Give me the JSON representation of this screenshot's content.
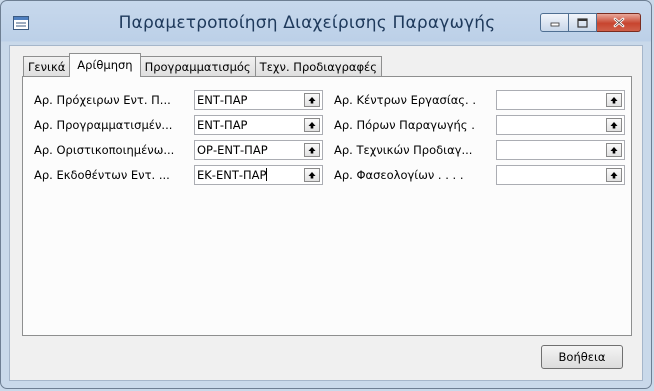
{
  "window": {
    "title": "Παραμετροποίηση Διαχείρισης Παραγωγής",
    "app_icon": "form-icon",
    "buttons": {
      "minimize": "minimize-icon",
      "maximize": "maximize-icon",
      "close": "close-icon"
    }
  },
  "tabs": [
    {
      "label": "Γενικά",
      "active": false
    },
    {
      "label": "Αρίθμηση",
      "active": true
    },
    {
      "label": "Προγραμματισμός",
      "active": false
    },
    {
      "label": "Τεχν. Προδιαγραφές",
      "active": false
    }
  ],
  "left_fields": [
    {
      "label": "Αρ. Πρόχειρων Εντ. Π...",
      "value": "ΕΝΤ-ΠΑΡ"
    },
    {
      "label": "Αρ. Προγραμματισμέν...",
      "value": "ΕΝΤ-ΠΑΡ"
    },
    {
      "label": "Αρ. Οριστικοποιημένω...",
      "value": "ΟΡ-ΕΝΤ-ΠΑΡ"
    },
    {
      "label": "Αρ. Εκδοθέντων Εντ. ...",
      "value": "ΕΚ-ΕΝΤ-ΠΑΡ"
    }
  ],
  "right_fields": [
    {
      "label": "Αρ. Κέντρων Εργασίας. .",
      "value": ""
    },
    {
      "label": "Αρ. Πόρων Παραγωγής .",
      "value": ""
    },
    {
      "label": "Αρ. Τεχνικών Προδιαγ...",
      "value": ""
    },
    {
      "label": "Αρ. Φασεολογίων . . . .",
      "value": ""
    }
  ],
  "help_button": "Βοήθεια",
  "lookup_icon": "assist-up-arrow-icon"
}
